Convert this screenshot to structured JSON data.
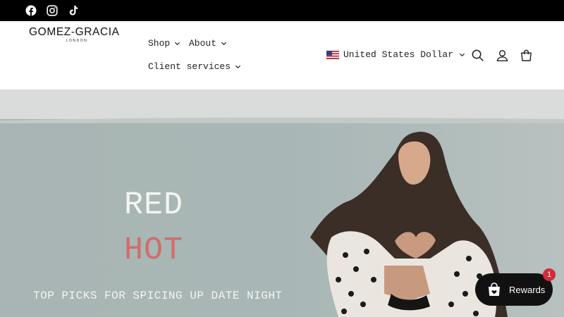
{
  "social": {
    "facebook": "facebook-icon",
    "instagram": "instagram-icon",
    "tiktok": "tiktok-icon"
  },
  "header": {
    "logo_main": "GOMEZ-GRACIA",
    "logo_sub": "LONDON",
    "nav": [
      {
        "label": "Shop"
      },
      {
        "label": "About"
      },
      {
        "label": "Client services"
      }
    ],
    "currency": "United States Dollar",
    "icons": [
      "search-icon",
      "account-icon",
      "cart-icon"
    ]
  },
  "hero": {
    "line1": "RED",
    "line2": "HOT",
    "subtitle": "TOP PICKS FOR SPICING UP DATE NIGHT",
    "accent_color": "#d16c6c"
  },
  "rewards": {
    "label": "Rewards",
    "badge": "1"
  },
  "colors": {
    "topbar": "#000000",
    "hero_wall": "#a9b7b6",
    "rewards_bg": "#111111",
    "badge": "#d42a3a"
  }
}
